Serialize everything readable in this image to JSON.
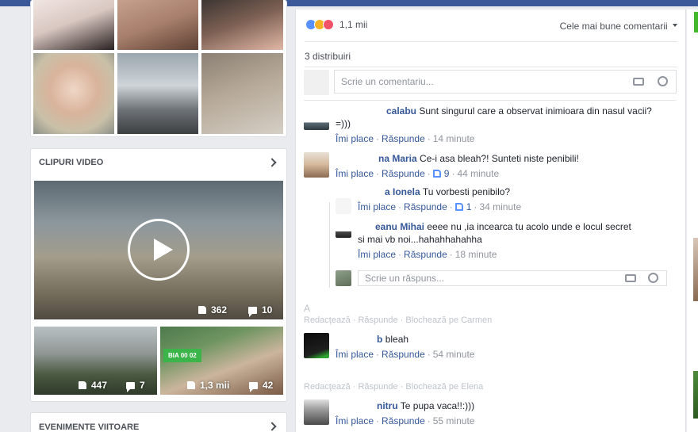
{
  "left": {
    "videos_title": "CLIPURI VIDEO",
    "events_title": "EVENIMENTE VIITOARE",
    "main_video": {
      "likes": "362",
      "comments": "10"
    },
    "small_videos": [
      {
        "likes": "447",
        "comments": "7"
      },
      {
        "likes": "1,3 mii",
        "comments": "42"
      }
    ],
    "small_video_overlay": "BIA 00 02"
  },
  "post": {
    "reaction_count": "1,1 mii",
    "sort_label": "Cele mai bune comentarii",
    "shares": "3 distribuiri",
    "comment_placeholder": "Scrie un comentariu...",
    "reply_placeholder": "Scrie un răspuns..."
  },
  "comments": [
    {
      "name": "calabu",
      "text": "Sunt singurul care a observat inimioara din nasul vacii?",
      "text2": "=)))",
      "like": "Îmi place",
      "reply": "Răspunde",
      "time": "14 minute"
    },
    {
      "name": "na Maria",
      "text": "Ce-i asa bleah?! Sunteti niste penibili!",
      "like": "Îmi place",
      "reply": "Răspunde",
      "likes": "9",
      "time": "44 minute"
    },
    {
      "name": "a Ionela",
      "text": "Tu vorbesti penibilo?",
      "like": "Îmi place",
      "reply": "Răspunde",
      "likes": "1",
      "time": "34 minute"
    },
    {
      "name": "eanu Mihai",
      "text": "eeee nu ,ia incearca tu acolo unde e locul secret",
      "text2": "si mai vb noi...hahahhahahha",
      "like": "Îmi place",
      "reply": "Răspunde",
      "time": "18 minute"
    },
    {
      "name": "b",
      "text": "bleah",
      "like": "Îmi place",
      "reply": "Răspunde",
      "time": "54 minute"
    },
    {
      "name": "nitru",
      "text": "Te pupa vaca!!:)))",
      "like": "Îmi place",
      "reply": "Răspunde",
      "time": "55 minute"
    }
  ],
  "ghosts": {
    "a": "A",
    "row1": "Redacţează · Răspunde · Blochează pe Carmen",
    "row2": "Redacţează · Răspunde · Blochează pe Elena"
  }
}
